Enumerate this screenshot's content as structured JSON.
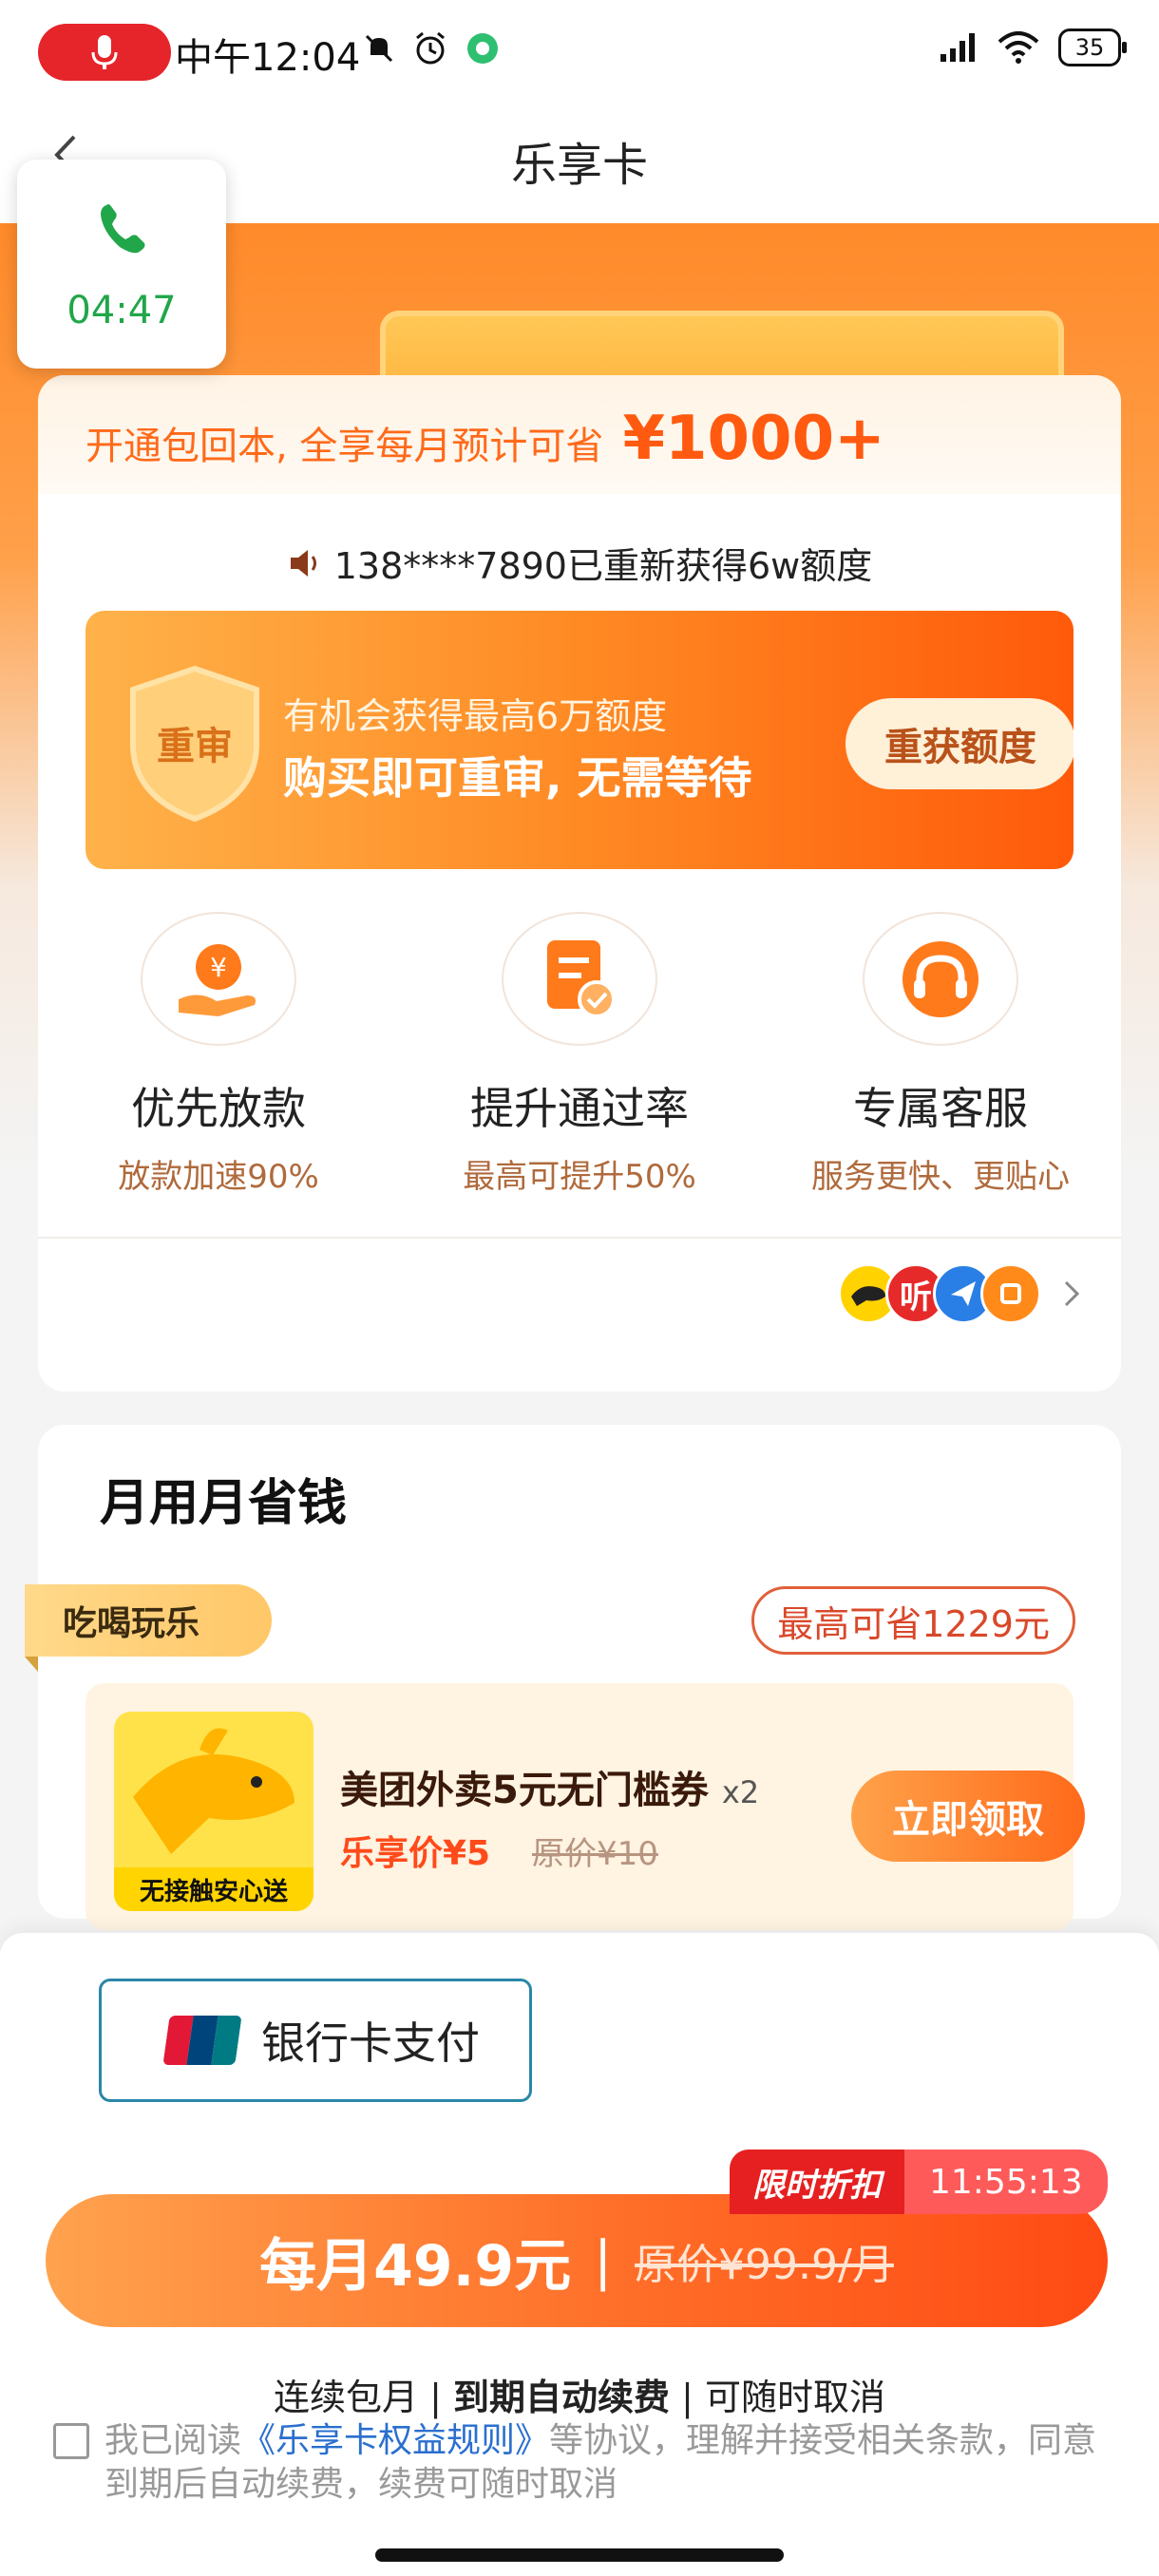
{
  "status_bar": {
    "time": "中午12:04",
    "battery": "35",
    "icons": [
      "mic-icon",
      "mute-icon",
      "alarm-icon",
      "app-notification-icon",
      "signal-icon",
      "wifi-icon",
      "battery-icon"
    ]
  },
  "nav": {
    "title": "乐享卡",
    "back_icon": "back-arrow-icon"
  },
  "call": {
    "duration": "04:47",
    "icon": "phone-icon"
  },
  "card": {
    "brand": "乐享卡",
    "save_text": "开通包回本, 全享每月预计可省",
    "save_amount": "¥1000+",
    "broadcast": "138****7890已重新获得6w额度",
    "banner": {
      "shield_label": "重审",
      "sub": "有机会获得最高6万额度",
      "main": "购买即可重审, 无需等待",
      "button": "重获额度"
    },
    "benefits": [
      {
        "title": "优先放款",
        "desc": "放款加速90%",
        "icon": "yuan-hand-icon"
      },
      {
        "title": "提升通过率",
        "desc": "最高可提升50%",
        "icon": "document-check-icon"
      },
      {
        "title": "专属客服",
        "desc": "服务更快、更贴心",
        "icon": "headset-icon"
      }
    ],
    "partners": [
      "听"
    ]
  },
  "monthly": {
    "title": "月用月省钱",
    "category_tag": "吃喝玩乐",
    "max_save": "最高可省1229元",
    "coupon": {
      "image_label": "无接触安心送",
      "title": "美团外卖5元无门槛券",
      "qty": "x2",
      "price": "乐享价¥5",
      "original": "原价¥10",
      "button": "立即领取"
    }
  },
  "sheet": {
    "pay_method": "银行卡支付",
    "unionpay_text": "UnionPay 银联",
    "timer_label": "限时折扣",
    "timer_value": "11:55:13",
    "cta_price": "每月49.9元",
    "cta_sep": "|",
    "cta_original": "原价¥99.9/月",
    "renew_a": "连续包月 | ",
    "renew_b": "到期自动续费",
    "renew_c": " | 可随时取消",
    "agree_prefix": "我已阅读",
    "agree_link": "《乐享卡权益规则》",
    "agree_suffix": "等协议，理解并接受相关条款，同意到期后自动续费，续费可随时取消"
  },
  "colors": {
    "accent": "#ff6a1a",
    "primary_text": "#222222",
    "link": "#2a6fcf",
    "timer_red": "#e62020",
    "call_green": "#21a64a"
  }
}
